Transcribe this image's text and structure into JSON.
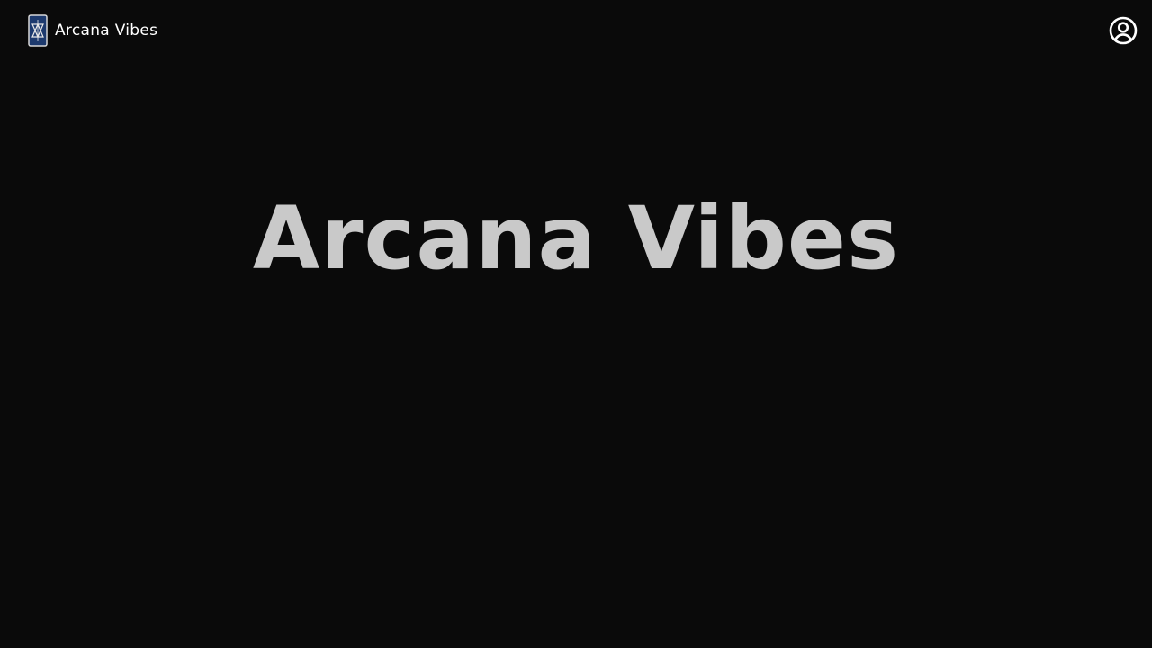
{
  "header": {
    "brand_name": "Arcana Vibes",
    "logo_icon": "tarot-card-icon",
    "account_icon": "user-circle-icon"
  },
  "hero": {
    "title": "Arcana Vibes"
  },
  "colors": {
    "background": "#0a0a0a",
    "brand_text": "#ffffff",
    "hero_text": "#c9c9c9",
    "logo_card": "#1d3a6e"
  }
}
